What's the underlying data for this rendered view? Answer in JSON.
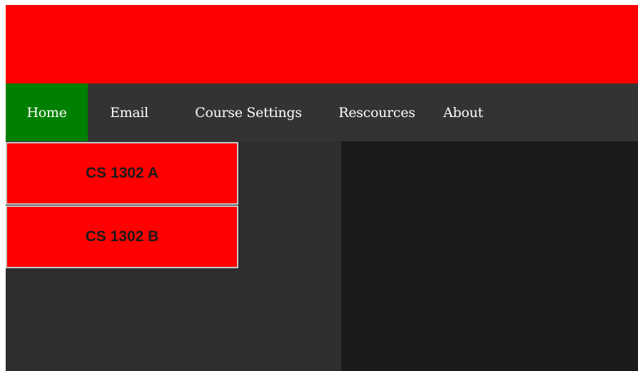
{
  "nav": {
    "items": [
      {
        "label": "Home",
        "active": true
      },
      {
        "label": "Email"
      },
      {
        "label": "Course Settings"
      },
      {
        "label": "Rescources"
      },
      {
        "label": "About"
      }
    ]
  },
  "courses": [
    {
      "label": "CS 1302 A"
    },
    {
      "label": "CS 1302 B"
    }
  ],
  "colors": {
    "header": "#ff0000",
    "nav_bg": "#333333",
    "nav_active": "#008000",
    "left_panel": "#2e2d2f",
    "right_panel": "#1b1b1b",
    "course_button": "#ff0000"
  }
}
